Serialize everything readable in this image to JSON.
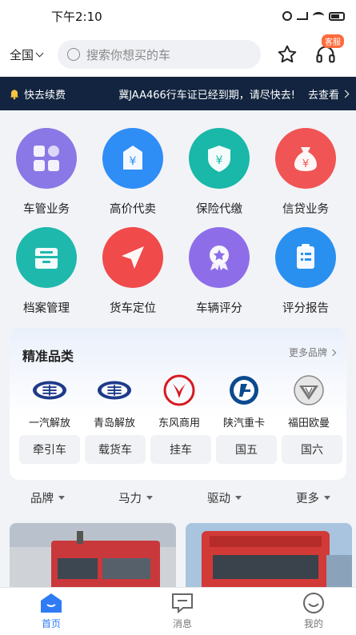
{
  "status_bar": {
    "time": "下午2:10",
    "battery": "67"
  },
  "header": {
    "region": "全国",
    "search_placeholder": "搜索你想买的车",
    "service_badge": "客服"
  },
  "notice": {
    "renew_label": "快去续费",
    "message": "冀JAA466行车证已经到期，请尽快去!",
    "action": "去查看"
  },
  "services": [
    {
      "label": "车管业务",
      "icon": "apps-icon",
      "color": "#8a78e6"
    },
    {
      "label": "高价代卖",
      "icon": "price-tag-icon",
      "color": "#2f8df6"
    },
    {
      "label": "保险代缴",
      "icon": "shield-yen-icon",
      "color": "#19b8a8"
    },
    {
      "label": "信贷业务",
      "icon": "money-bag-icon",
      "color": "#f05454"
    },
    {
      "label": "档案管理",
      "icon": "archive-icon",
      "color": "#1fb8ad"
    },
    {
      "label": "货车定位",
      "icon": "location-arrow-icon",
      "color": "#f04a4a"
    },
    {
      "label": "车辆评分",
      "icon": "rating-badge-icon",
      "color": "#8e6ee8"
    },
    {
      "label": "评分报告",
      "icon": "report-icon",
      "color": "#2a90f0"
    }
  ],
  "categories": {
    "title": "精准品类",
    "more": "更多品牌",
    "brands": [
      {
        "name": "一汽解放",
        "icon": "faw-logo-icon"
      },
      {
        "name": "青岛解放",
        "icon": "faw-qingdao-logo-icon"
      },
      {
        "name": "东风商用",
        "icon": "dongfeng-logo-icon"
      },
      {
        "name": "陕汽重卡",
        "icon": "shacman-logo-icon"
      },
      {
        "name": "福田欧曼",
        "icon": "foton-logo-icon"
      }
    ],
    "types": [
      "牵引车",
      "载货车",
      "挂车",
      "国五",
      "国六"
    ]
  },
  "filters": [
    "品牌",
    "马力",
    "驱动",
    "更多"
  ],
  "tabs": [
    {
      "label": "首页",
      "icon": "home-icon",
      "active": true
    },
    {
      "label": "消息",
      "icon": "message-icon",
      "active": false
    },
    {
      "label": "我的",
      "icon": "profile-icon",
      "active": false
    }
  ]
}
